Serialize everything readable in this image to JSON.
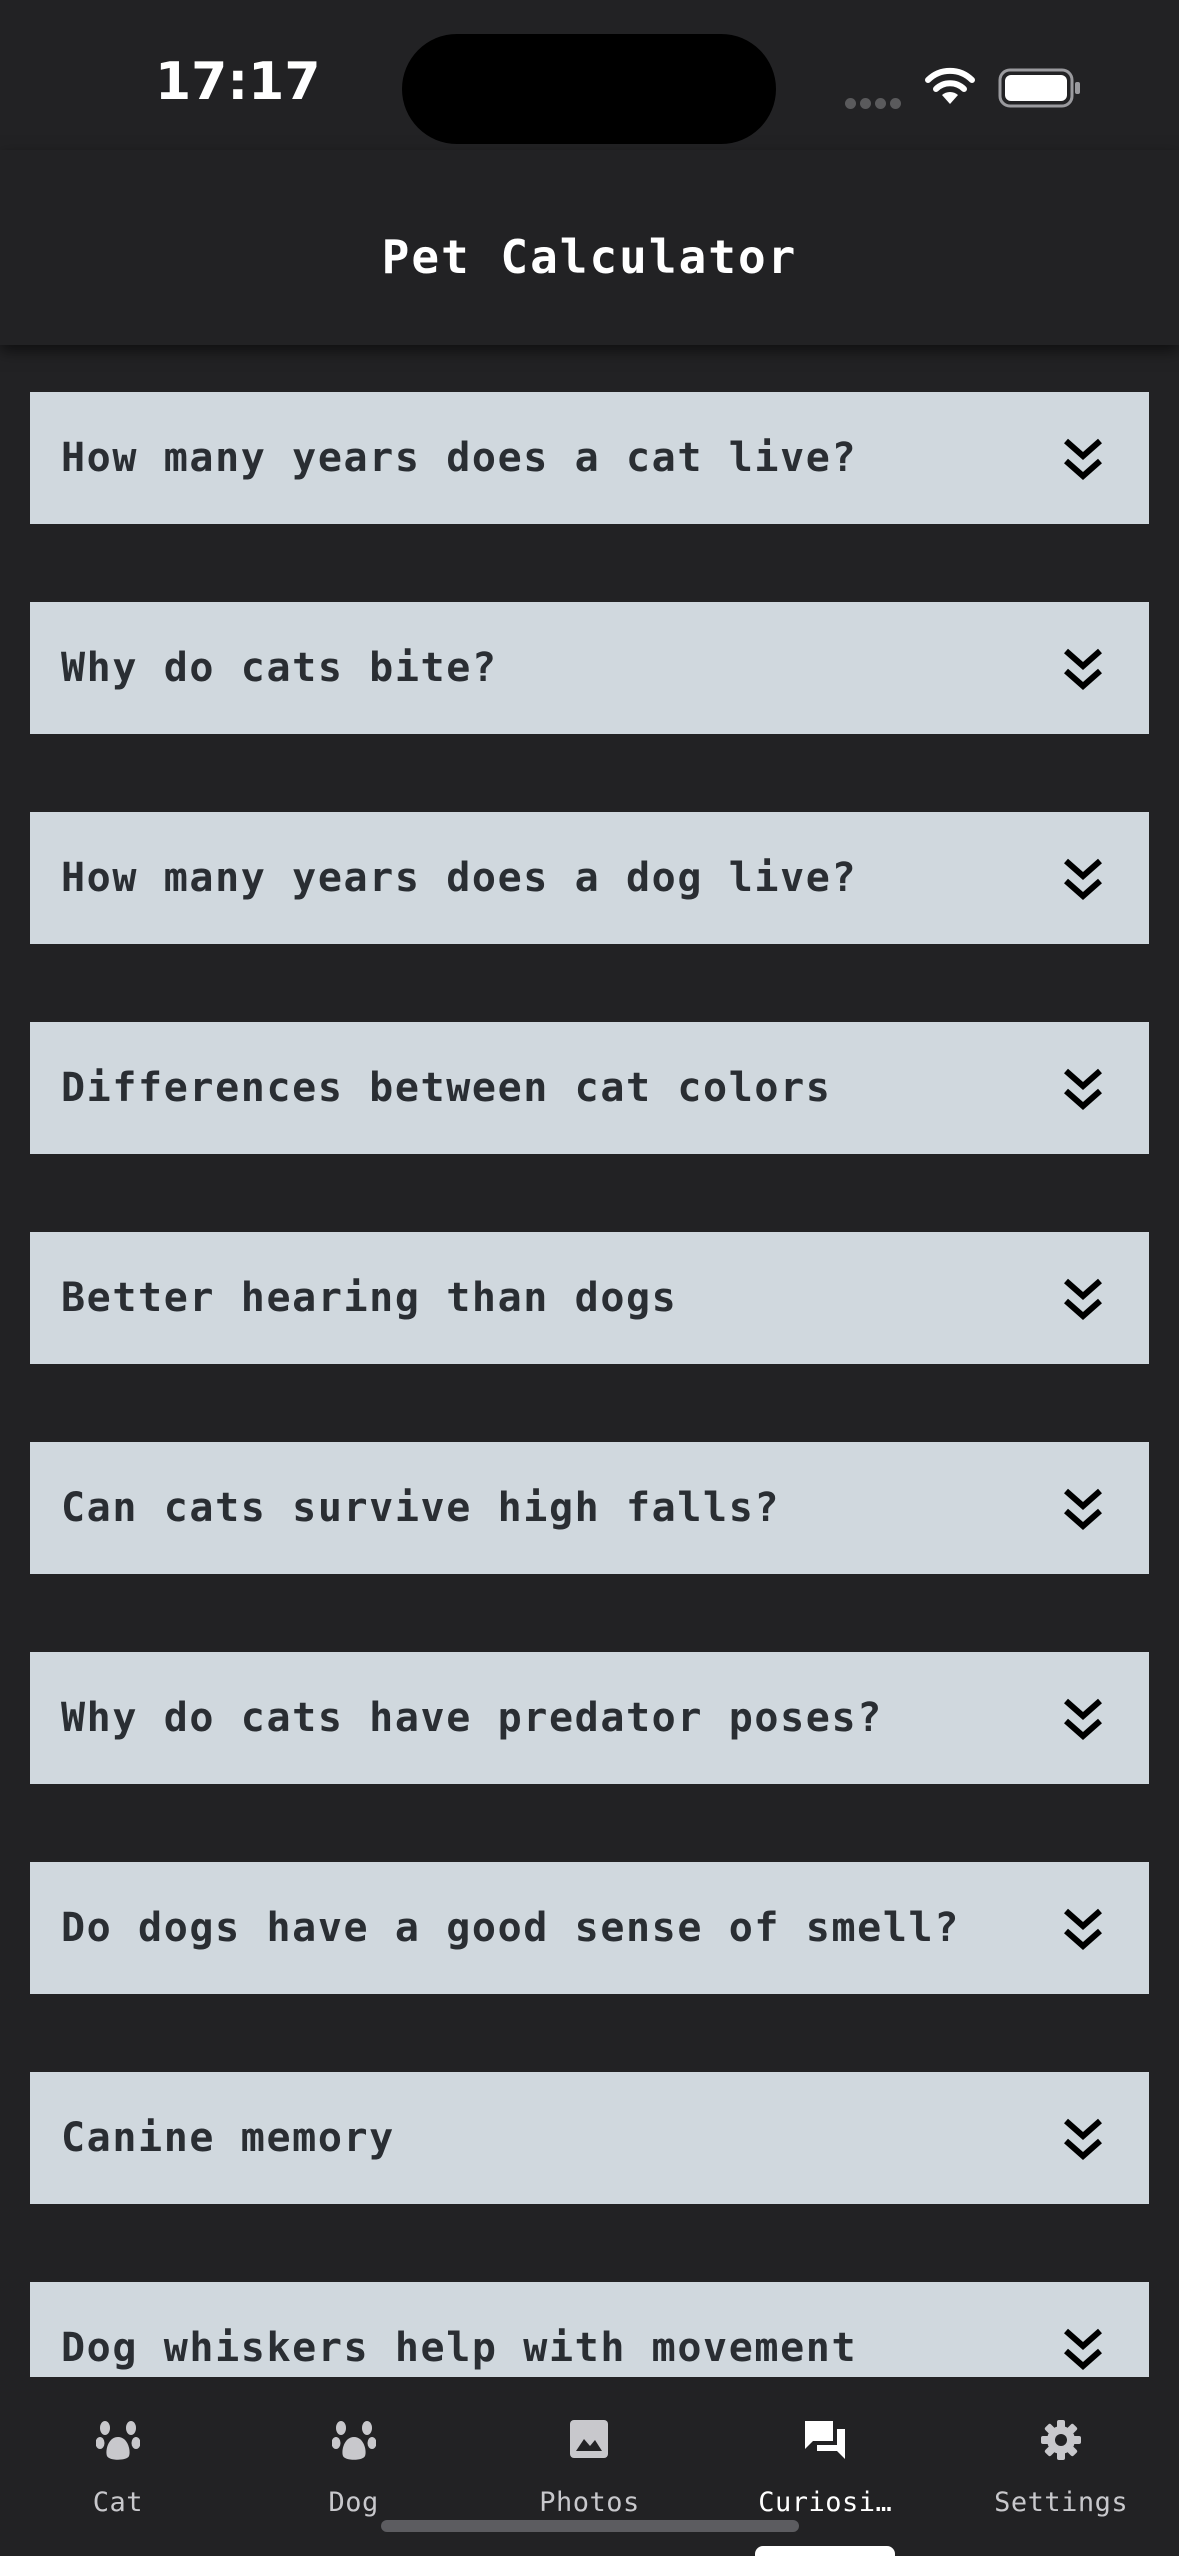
{
  "status_bar": {
    "time": "17:17"
  },
  "header": {
    "title": "Pet Calculator"
  },
  "faq": [
    {
      "question": "How many years does a cat live?"
    },
    {
      "question": "Why do cats bite?"
    },
    {
      "question": "How many years does a dog live?"
    },
    {
      "question": "Differences between cat colors"
    },
    {
      "question": "Better hearing than dogs"
    },
    {
      "question": "Can cats survive high falls?"
    },
    {
      "question": "Why do cats have predator poses?"
    },
    {
      "question": "Do dogs have a good sense of smell?"
    },
    {
      "question": "Canine memory"
    },
    {
      "question": "Dog whiskers help with movement"
    }
  ],
  "tabs": [
    {
      "label": "Cat",
      "icon": "paw-icon"
    },
    {
      "label": "Dog",
      "icon": "paw-icon"
    },
    {
      "label": "Photos",
      "icon": "image-icon"
    },
    {
      "label": "Curiosi…",
      "icon": "chat-icon",
      "active": true
    },
    {
      "label": "Settings",
      "icon": "gear-icon"
    }
  ],
  "colors": {
    "background": "#222224",
    "card": "#d0d8de",
    "card_text": "#2a2e33",
    "tab_inactive": "#c8c8cc",
    "tab_active": "#ffffff"
  }
}
